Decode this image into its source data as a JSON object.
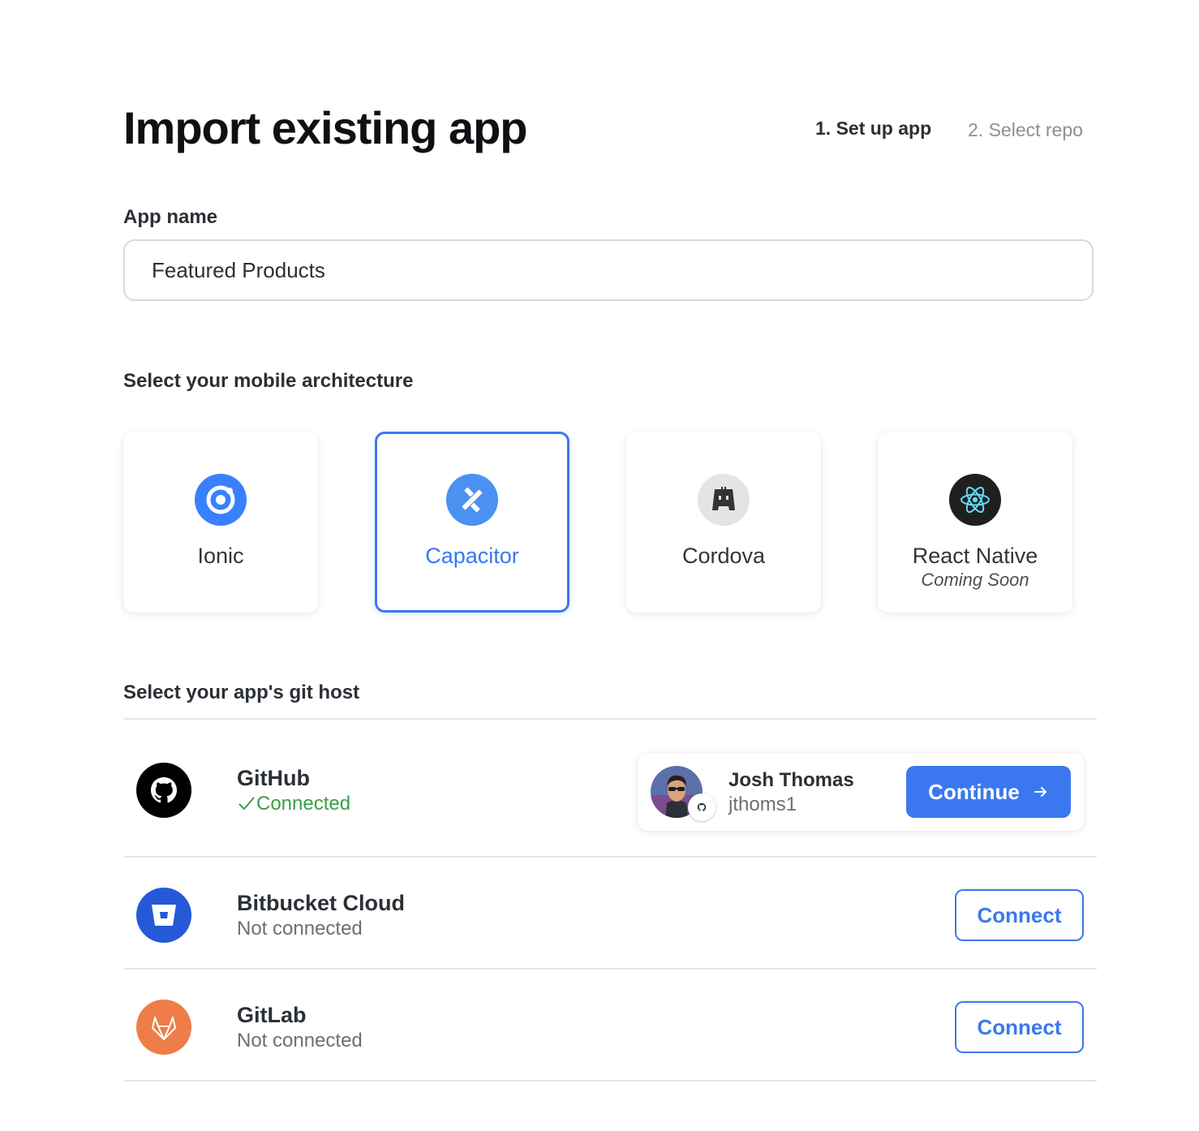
{
  "page": {
    "title": "Import existing app"
  },
  "steps": [
    {
      "label": "1. Set up app",
      "active": true
    },
    {
      "label": "2. Select repo",
      "active": false
    }
  ],
  "app_name": {
    "label": "App name",
    "value": "Featured Products"
  },
  "architecture": {
    "label": "Select your mobile architecture",
    "options": [
      {
        "name": "Ionic",
        "sub": "",
        "icon": "ionic-logo-icon",
        "color": "#3880ff",
        "selected": false
      },
      {
        "name": "Capacitor",
        "sub": "",
        "icon": "capacitor-logo-icon",
        "color": "#4a91f2",
        "selected": true
      },
      {
        "name": "Cordova",
        "sub": "",
        "icon": "cordova-logo-icon",
        "color": "#e4e4e4",
        "selected": false
      },
      {
        "name": "React Native",
        "sub": "Coming Soon",
        "icon": "react-logo-icon",
        "color": "#1f1f1f",
        "selected": false
      }
    ]
  },
  "git_host": {
    "label": "Select your app's git host",
    "hosts": [
      {
        "name": "GitHub",
        "status": "Connected",
        "icon": "github-logo-icon",
        "color": "#000000"
      },
      {
        "name": "Bitbucket Cloud",
        "status": "Not connected",
        "icon": "bitbucket-logo-icon",
        "color": "#2559d7",
        "action": "Connect"
      },
      {
        "name": "GitLab",
        "status": "Not connected",
        "icon": "gitlab-logo-icon",
        "color": "#ee7d49",
        "action": "Connect"
      }
    ],
    "user": {
      "name": "Josh Thomas",
      "handle": "jthoms1",
      "action": "Continue"
    }
  },
  "colors": {
    "accent": "#3b78f0",
    "success": "#3b9e4a",
    "muted": "#6a6f75"
  }
}
